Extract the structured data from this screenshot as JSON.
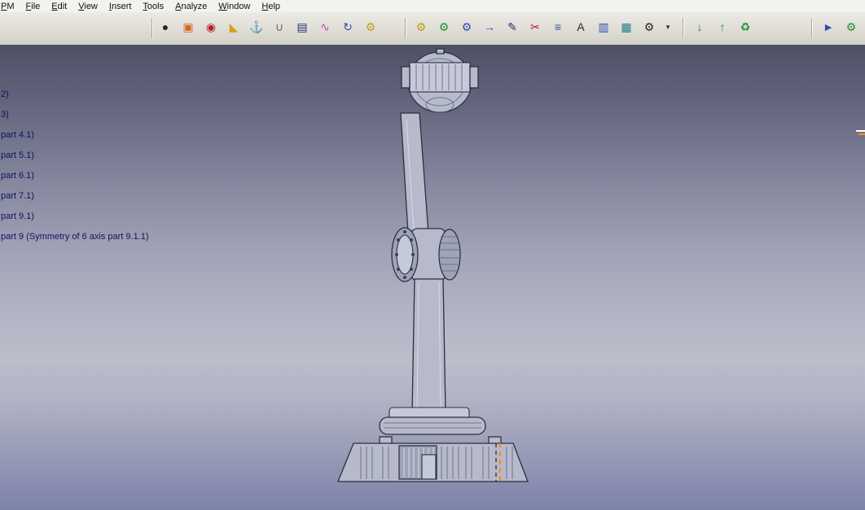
{
  "menu": {
    "items": [
      {
        "label": "PM"
      },
      {
        "label": "File"
      },
      {
        "label": "Edit"
      },
      {
        "label": "View"
      },
      {
        "label": "Insert"
      },
      {
        "label": "Tools"
      },
      {
        "label": "Analyze"
      },
      {
        "label": "Window"
      },
      {
        "label": "Help"
      }
    ]
  },
  "toolbar": {
    "groups": [
      {
        "name": "view-tools",
        "icons": [
          {
            "name": "shaded-sphere-icon",
            "glyph": "●"
          },
          {
            "name": "view-cube-icon",
            "glyph": "▣"
          },
          {
            "name": "camera-icon",
            "glyph": "◉"
          },
          {
            "name": "measure-triangle-icon",
            "glyph": "◣"
          },
          {
            "name": "anchor-icon",
            "glyph": "⚓"
          },
          {
            "name": "paperclip-icon",
            "glyph": "∪"
          },
          {
            "name": "storyboard-icon",
            "glyph": "▤"
          },
          {
            "name": "curve-trace-icon",
            "glyph": "∿"
          },
          {
            "name": "update-swirl-icon",
            "glyph": "↻"
          },
          {
            "name": "gears-icon",
            "glyph": "⚙"
          }
        ]
      },
      {
        "name": "process-tools",
        "icons": [
          {
            "name": "process-gear-icon",
            "glyph": "⚙"
          },
          {
            "name": "gear-add-icon",
            "glyph": "⚙"
          },
          {
            "name": "gear-time-icon",
            "glyph": "⚙"
          },
          {
            "name": "doc-forward-icon",
            "glyph": "→"
          },
          {
            "name": "edit-pencil-icon",
            "glyph": "✎"
          },
          {
            "name": "cut-scissors-icon",
            "glyph": "✂"
          },
          {
            "name": "list-lines-icon",
            "glyph": "≡"
          },
          {
            "name": "text-annotation-icon",
            "glyph": "A"
          },
          {
            "name": "copy-sheet-icon",
            "glyph": "▥"
          },
          {
            "name": "table-grid-icon",
            "glyph": "▦"
          },
          {
            "name": "gear-settings-icon",
            "glyph": "⚙"
          },
          {
            "name": "more-dropdown-arrow",
            "glyph": "▾"
          }
        ]
      },
      {
        "name": "data-exchange-tools",
        "icons": [
          {
            "name": "import-data-icon",
            "glyph": "↓"
          },
          {
            "name": "export-data-icon",
            "glyph": "↑"
          },
          {
            "name": "refresh-data-icon",
            "glyph": "♻"
          }
        ]
      },
      {
        "name": "right-tools",
        "icons": [
          {
            "name": "pointer-tool-icon",
            "glyph": "►"
          },
          {
            "name": "machine-gears-icon",
            "glyph": "⚙"
          }
        ]
      }
    ]
  },
  "tree": {
    "items": [
      {
        "label": "2)"
      },
      {
        "label": "3)"
      },
      {
        "label": "part 4.1)"
      },
      {
        "label": "part 5.1)"
      },
      {
        "label": "part 6.1)"
      },
      {
        "label": "part 7.1)"
      },
      {
        "label": "part 9.1)"
      },
      {
        "label": "part 9 (Symmetry of 6 axis part 9.1.1)"
      }
    ]
  },
  "viewport": {
    "background_top": "#4e5066",
    "background_mid": "#bcbcca",
    "background_bottom": "#7d82aa",
    "selection_dash_color": "#ff8c1a",
    "model_fill": "#b7bacb",
    "model_outline": "#2a2f3e"
  }
}
